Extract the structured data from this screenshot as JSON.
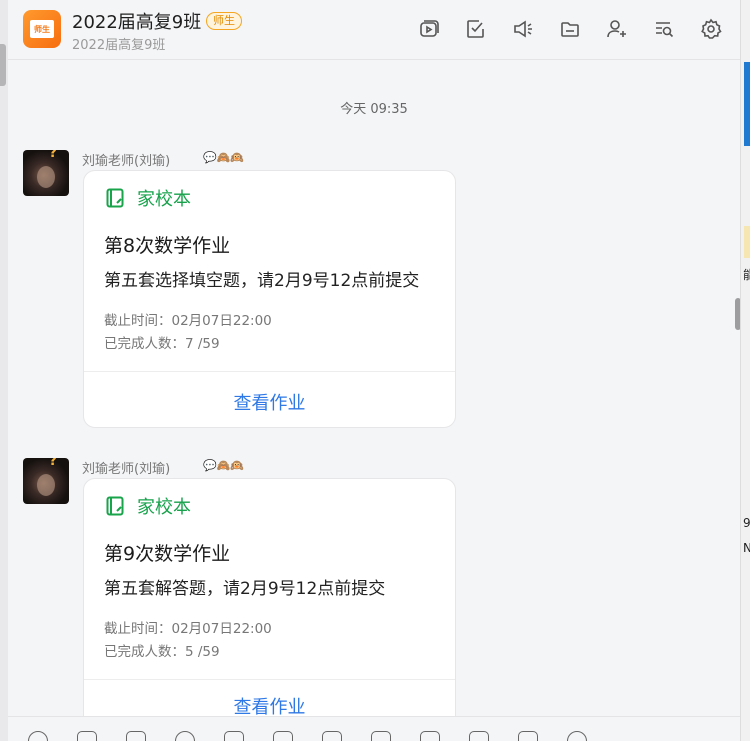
{
  "header": {
    "logo_text": "师生",
    "title": "2022届高复9班",
    "tag": "师生",
    "subtitle": "2022届高复9班",
    "toolbar_icons": [
      "video-icon",
      "task-icon",
      "announcement-icon",
      "folder-icon",
      "add-member-icon",
      "search-history-icon",
      "settings-icon"
    ]
  },
  "timestamp": "今天 09:35",
  "messages": [
    {
      "sender": "刘瑜老师(刘瑜)",
      "card": {
        "source": "家校本",
        "title": "第8次数学作业",
        "description": "第五套选择填空题，请2月9号12点前提交",
        "deadline": "截止时间：02月07日22:00",
        "completed": "已完成人数：7 /59",
        "action": "查看作业"
      }
    },
    {
      "sender": "刘瑜老师(刘瑜)",
      "card": {
        "source": "家校本",
        "title": "第9次数学作业",
        "description": "第五套解答题，请2月9号12点前提交",
        "deadline": "截止时间：02月07日22:00",
        "completed": "已完成人数：5 /59",
        "action": "查看作业"
      }
    }
  ],
  "right_panel": {
    "glyph_1": "能",
    "glyph_2": "9",
    "glyph_3": "N"
  },
  "colors": {
    "accent_green": "#18a24c",
    "link_blue": "#2f79e6",
    "tag_orange": "#e48a00"
  }
}
